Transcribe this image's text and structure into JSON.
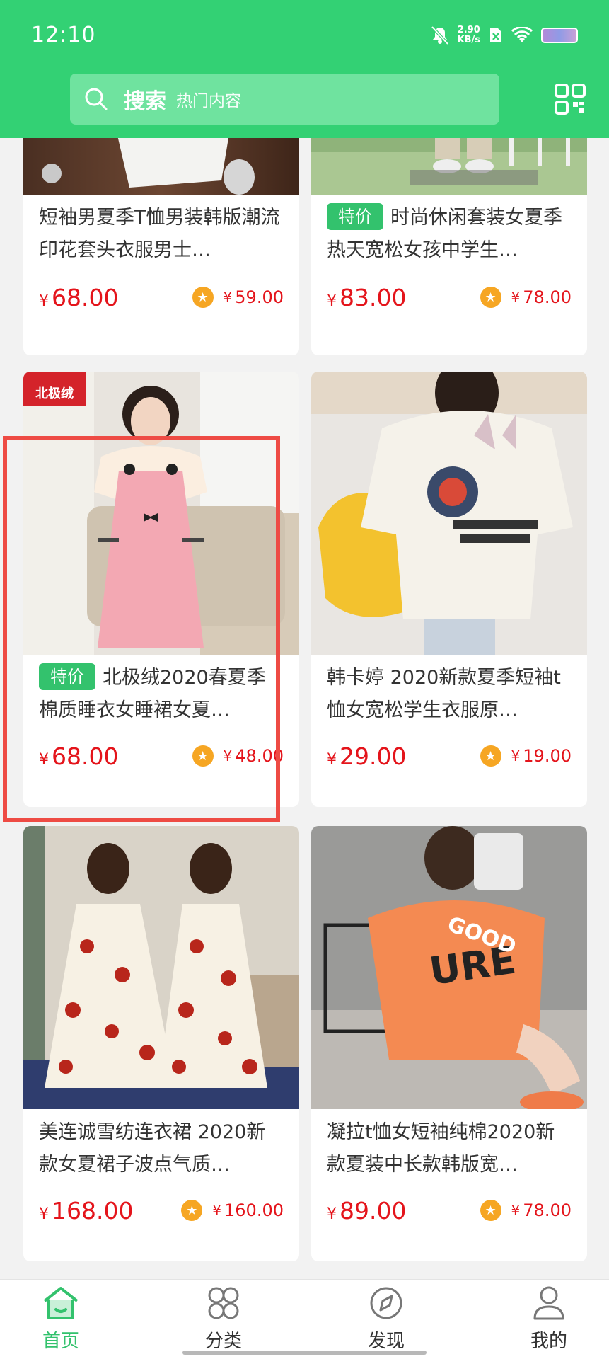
{
  "status_bar": {
    "time": "12:10",
    "net_speed_value": "2.90",
    "net_speed_unit": "KB/s",
    "icons": [
      "mute-bell-icon",
      "no-sim-icon",
      "wifi-icon",
      "battery-icon"
    ]
  },
  "search": {
    "label": "搜索",
    "placeholder": "热门内容"
  },
  "colors": {
    "brand_green": "#33d174",
    "price_red": "#e4141b",
    "tag_green": "#33c26d",
    "vip_badge": "#f6a623",
    "highlight_red": "#ee4b44"
  },
  "products": [
    {
      "tag": "",
      "title": "短袖男夏季T恤男装韩版潮流印花套头衣服男士…",
      "price_symbol": "¥",
      "price": "68.00",
      "vip_symbol": "¥",
      "vip_price": "59.00"
    },
    {
      "tag": "特价",
      "title": "时尚休闲套装女夏季热天宽松女孩中学生…",
      "price_symbol": "¥",
      "price": "83.00",
      "vip_symbol": "¥",
      "vip_price": "78.00"
    },
    {
      "tag": "特价",
      "title": "北极绒2020春夏季棉质睡衣女睡裙女夏…",
      "price_symbol": "¥",
      "price": "68.00",
      "vip_symbol": "¥",
      "vip_price": "48.00",
      "image_brand": "北极绒"
    },
    {
      "tag": "",
      "title": "韩卡婷 2020新款夏季短袖t恤女宽松学生衣服原…",
      "price_symbol": "¥",
      "price": "29.00",
      "vip_symbol": "¥",
      "vip_price": "19.00"
    },
    {
      "tag": "",
      "title": "美连诚雪纺连衣裙 2020新款女夏裙子波点气质…",
      "price_symbol": "¥",
      "price": "168.00",
      "vip_symbol": "¥",
      "vip_price": "160.00"
    },
    {
      "tag": "",
      "title": "凝拉t恤女短袖纯棉2020新款夏装中长款韩版宽…",
      "price_symbol": "¥",
      "price": "89.00",
      "vip_symbol": "¥",
      "vip_price": "78.00"
    }
  ],
  "bottom_nav": [
    {
      "label": "首页",
      "icon": "home-icon",
      "active": true
    },
    {
      "label": "分类",
      "icon": "category-grid-icon",
      "active": false
    },
    {
      "label": "发现",
      "icon": "compass-icon",
      "active": false
    },
    {
      "label": "我的",
      "icon": "profile-icon",
      "active": false
    }
  ]
}
